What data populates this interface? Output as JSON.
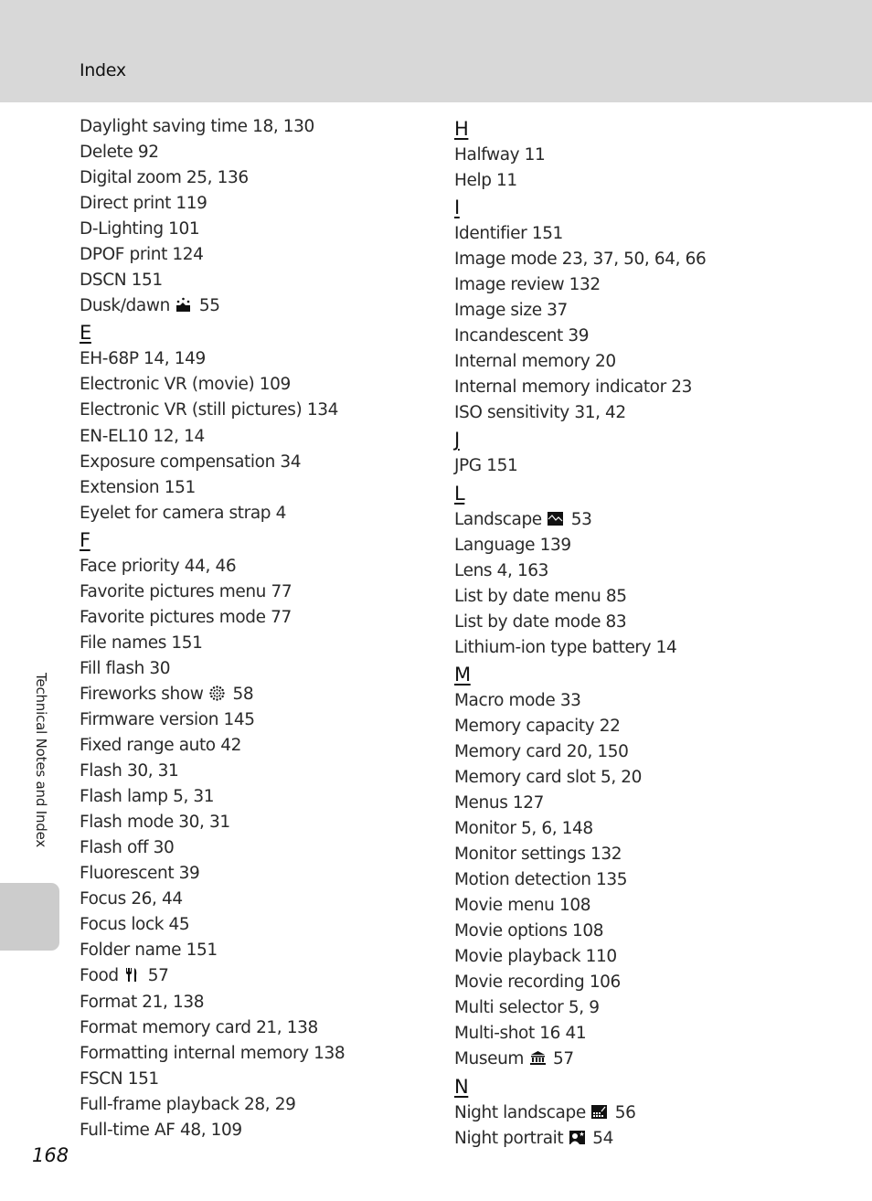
{
  "header": {
    "title": "Index"
  },
  "side_tab": {
    "label": "Technical Notes and Index"
  },
  "page_number": "168",
  "left_column": [
    {
      "type": "entry",
      "text": "Daylight saving time 18, 130"
    },
    {
      "type": "entry",
      "text": "Delete 92"
    },
    {
      "type": "entry",
      "text": "Digital zoom 25, 136"
    },
    {
      "type": "entry",
      "text": "Direct print 119"
    },
    {
      "type": "entry",
      "text": "D-Lighting 101"
    },
    {
      "type": "entry",
      "text": "DPOF print 124"
    },
    {
      "type": "entry",
      "text": "DSCN 151"
    },
    {
      "type": "entry",
      "text": "Dusk/dawn",
      "icon": "dusk-dawn-icon",
      "pages": "55"
    },
    {
      "type": "letter",
      "text": "E"
    },
    {
      "type": "entry",
      "text": "EH-68P 14, 149"
    },
    {
      "type": "entry",
      "text": "Electronic VR (movie) 109"
    },
    {
      "type": "entry",
      "text": "Electronic VR (still pictures) 134"
    },
    {
      "type": "entry",
      "text": "EN-EL10 12, 14"
    },
    {
      "type": "entry",
      "text": "Exposure compensation 34"
    },
    {
      "type": "entry",
      "text": "Extension 151"
    },
    {
      "type": "entry",
      "text": "Eyelet for camera strap 4"
    },
    {
      "type": "letter",
      "text": "F"
    },
    {
      "type": "entry",
      "text": "Face priority 44, 46"
    },
    {
      "type": "entry",
      "text": "Favorite pictures menu 77"
    },
    {
      "type": "entry",
      "text": "Favorite pictures mode 77"
    },
    {
      "type": "entry",
      "text": "File names 151"
    },
    {
      "type": "entry",
      "text": "Fill flash 30"
    },
    {
      "type": "entry",
      "text": "Fireworks show",
      "icon": "fireworks-icon",
      "pages": "58"
    },
    {
      "type": "entry",
      "text": "Firmware version 145"
    },
    {
      "type": "entry",
      "text": "Fixed range auto 42"
    },
    {
      "type": "entry",
      "text": "Flash 30, 31"
    },
    {
      "type": "entry",
      "text": "Flash lamp 5, 31"
    },
    {
      "type": "entry",
      "text": "Flash mode 30, 31"
    },
    {
      "type": "entry",
      "text": "Flash off 30"
    },
    {
      "type": "entry",
      "text": "Fluorescent 39"
    },
    {
      "type": "entry",
      "text": "Focus 26, 44"
    },
    {
      "type": "entry",
      "text": "Focus lock 45"
    },
    {
      "type": "entry",
      "text": "Folder name 151"
    },
    {
      "type": "entry",
      "text": "Food",
      "icon": "food-icon",
      "pages": "57"
    },
    {
      "type": "entry",
      "text": "Format 21, 138"
    },
    {
      "type": "entry",
      "text": "Format memory card 21, 138"
    },
    {
      "type": "entry",
      "text": "Formatting internal memory 138"
    },
    {
      "type": "entry",
      "text": "FSCN 151"
    },
    {
      "type": "entry",
      "text": "Full-frame playback 28, 29"
    },
    {
      "type": "entry",
      "text": "Full-time AF 48, 109"
    }
  ],
  "right_column": [
    {
      "type": "letter",
      "text": "H"
    },
    {
      "type": "entry",
      "text": "Halfway 11"
    },
    {
      "type": "entry",
      "text": "Help 11"
    },
    {
      "type": "letter",
      "text": "I"
    },
    {
      "type": "entry",
      "text": "Identifier 151"
    },
    {
      "type": "entry",
      "text": "Image mode 23, 37, 50, 64, 66"
    },
    {
      "type": "entry",
      "text": "Image review 132"
    },
    {
      "type": "entry",
      "text": "Image size 37"
    },
    {
      "type": "entry",
      "text": "Incandescent 39"
    },
    {
      "type": "entry",
      "text": "Internal memory 20"
    },
    {
      "type": "entry",
      "text": "Internal memory indicator 23"
    },
    {
      "type": "entry",
      "text": "ISO sensitivity 31, 42"
    },
    {
      "type": "letter",
      "text": "J"
    },
    {
      "type": "entry",
      "text": "JPG 151"
    },
    {
      "type": "letter",
      "text": "L"
    },
    {
      "type": "entry",
      "text": "Landscape",
      "icon": "landscape-icon",
      "pages": "53"
    },
    {
      "type": "entry",
      "text": "Language 139"
    },
    {
      "type": "entry",
      "text": "Lens 4, 163"
    },
    {
      "type": "entry",
      "text": "List by date menu 85"
    },
    {
      "type": "entry",
      "text": "List by date mode 83"
    },
    {
      "type": "entry",
      "text": "Lithium-ion type battery 14"
    },
    {
      "type": "letter",
      "text": "M"
    },
    {
      "type": "entry",
      "text": "Macro mode 33"
    },
    {
      "type": "entry",
      "text": "Memory capacity 22"
    },
    {
      "type": "entry",
      "text": "Memory card 20, 150"
    },
    {
      "type": "entry",
      "text": "Memory card slot 5, 20"
    },
    {
      "type": "entry",
      "text": "Menus 127"
    },
    {
      "type": "entry",
      "text": "Monitor 5, 6, 148"
    },
    {
      "type": "entry",
      "text": "Monitor settings 132"
    },
    {
      "type": "entry",
      "text": "Motion detection 135"
    },
    {
      "type": "entry",
      "text": "Movie menu 108"
    },
    {
      "type": "entry",
      "text": "Movie options 108"
    },
    {
      "type": "entry",
      "text": "Movie playback 110"
    },
    {
      "type": "entry",
      "text": "Movie recording 106"
    },
    {
      "type": "entry",
      "text": "Multi selector 5, 9"
    },
    {
      "type": "entry",
      "text": "Multi-shot 16 41"
    },
    {
      "type": "entry",
      "text": "Museum",
      "icon": "museum-icon",
      "pages": "57"
    },
    {
      "type": "letter",
      "text": "N"
    },
    {
      "type": "entry",
      "text": "Night landscape",
      "icon": "night-landscape-icon",
      "pages": "56"
    },
    {
      "type": "entry",
      "text": "Night portrait",
      "icon": "night-portrait-icon",
      "pages": "54"
    }
  ]
}
